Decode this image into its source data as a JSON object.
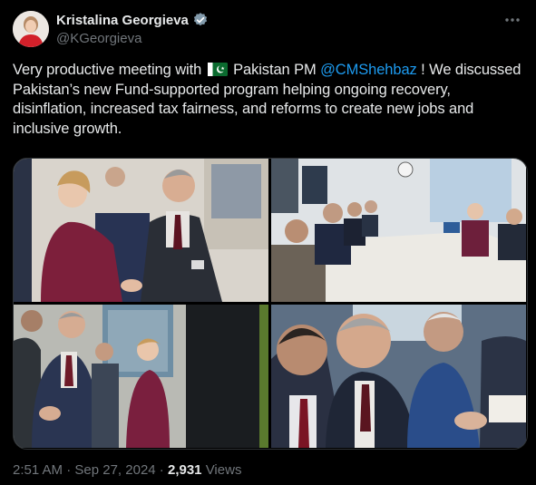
{
  "author": {
    "display_name": "Kristalina Georgieva",
    "handle": "@KGeorgieva",
    "verified_icon": "verified-badge-icon",
    "avatar_icon": "profile-avatar"
  },
  "menu": {
    "icon": "more-options-icon"
  },
  "tweet": {
    "part1": "Very productive meeting with ",
    "flag_icon": "pakistan-flag-emoji",
    "part2": " Pakistan PM ",
    "mention": "@CMShehbaz",
    "part3": " ! We discussed Pakistan’s new Fund-supported program helping ongoing recovery, disinflation, increased tax fairness, and reforms to create new jobs and inclusive growth."
  },
  "media": {
    "photos": [
      {
        "name": "photo-handshake"
      },
      {
        "name": "photo-meeting-table"
      },
      {
        "name": "photo-greeting"
      },
      {
        "name": "photo-delegation-closeup"
      }
    ]
  },
  "meta": {
    "time": "2:51 AM",
    "separator1": " · ",
    "date": "Sep 27, 2024",
    "separator2": " · ",
    "views_count": "2,931",
    "views_label": " Views"
  },
  "colors": {
    "background": "#000000",
    "text": "#e7e9ea",
    "secondary": "#71767b",
    "link": "#1d9bf0"
  }
}
